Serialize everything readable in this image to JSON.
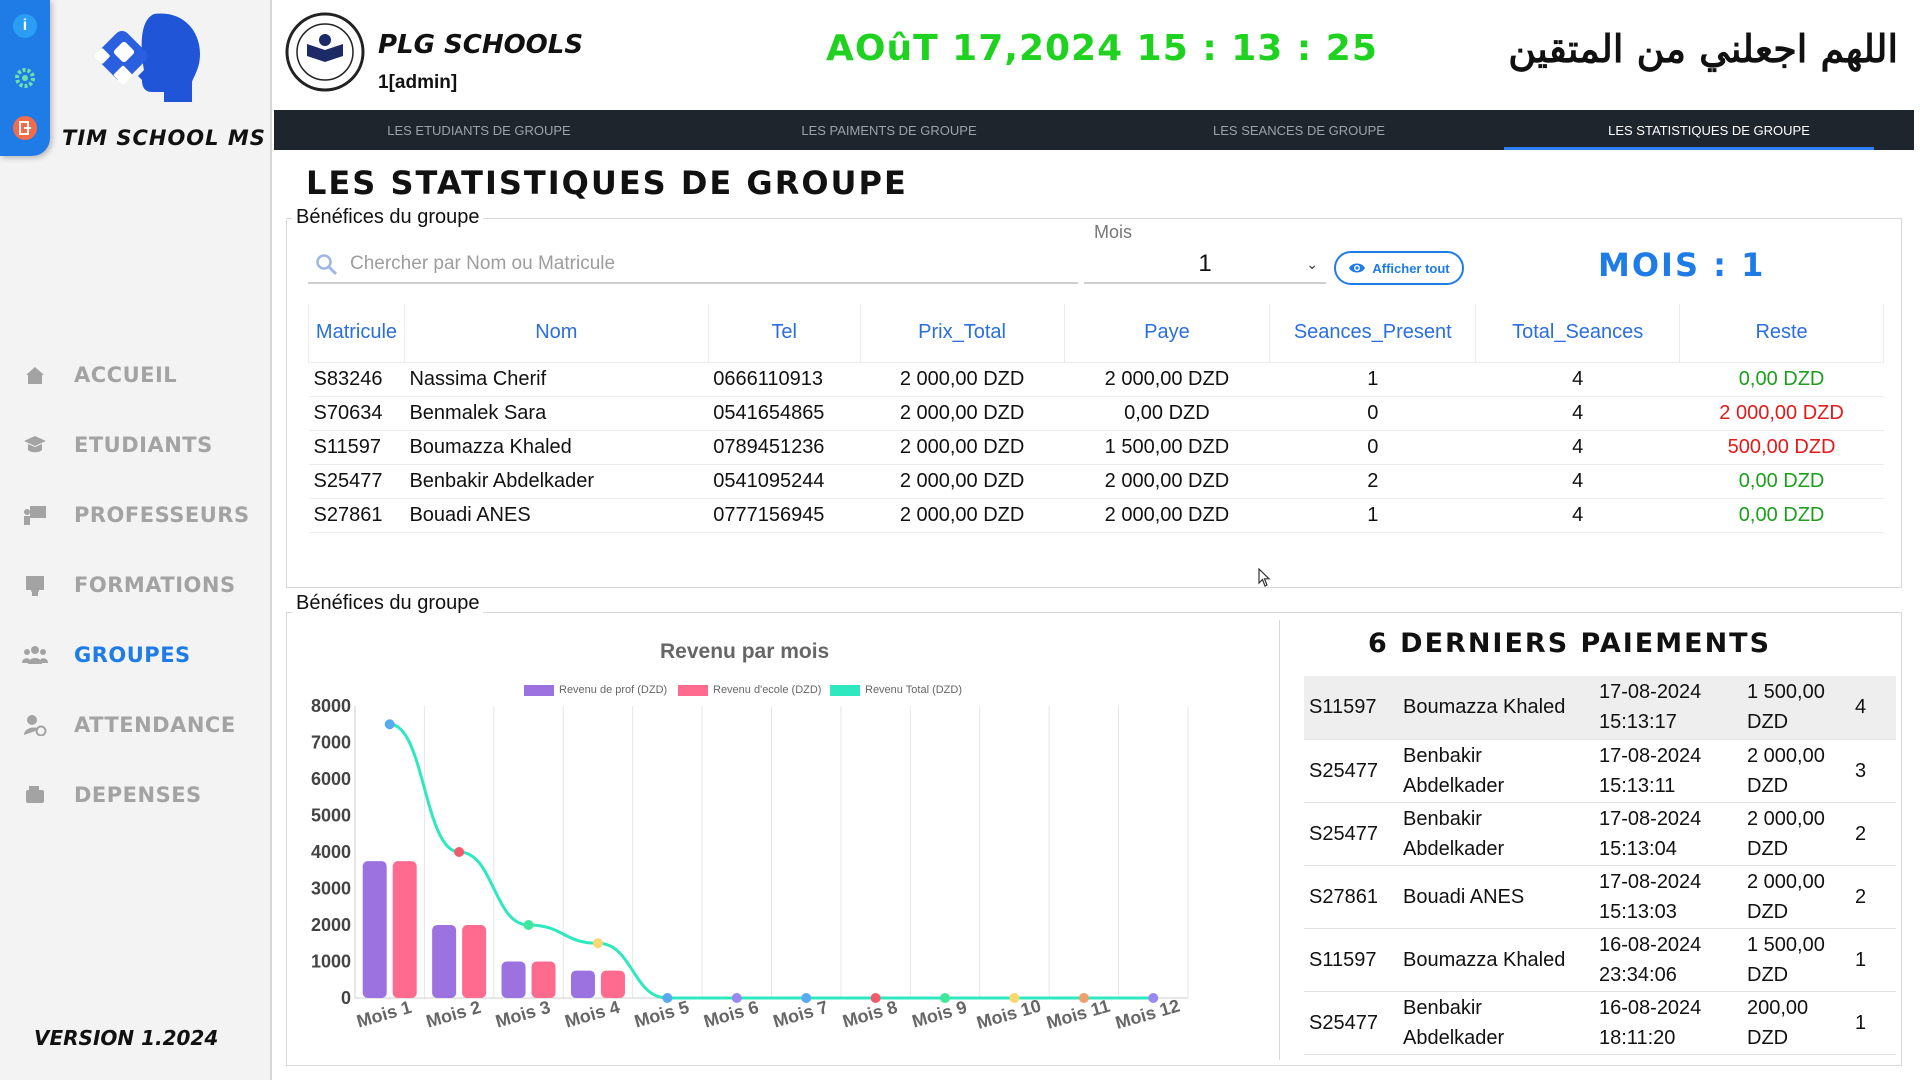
{
  "app": {
    "brand": "TIM SCHOOL MS",
    "version": "VERSION 1.2024",
    "accent": "#1f7be6"
  },
  "quick_actions": [
    {
      "icon": "info-icon",
      "label": "i"
    },
    {
      "icon": "gear-icon",
      "label": ""
    },
    {
      "icon": "logout-icon",
      "label": ""
    }
  ],
  "sidebar": {
    "items": [
      {
        "label": "ACCUEIL",
        "icon": "home-icon",
        "active": false
      },
      {
        "label": "ETUDIANTS",
        "icon": "graduation-cap-icon",
        "active": false
      },
      {
        "label": "PROFESSEURS",
        "icon": "teacher-board-icon",
        "active": false
      },
      {
        "label": "FORMATIONS",
        "icon": "certificate-icon",
        "active": false
      },
      {
        "label": "GROUPES",
        "icon": "users-icon",
        "active": true
      },
      {
        "label": "ATTENDANCE",
        "icon": "user-clock-icon",
        "active": false
      },
      {
        "label": "DEPENSES",
        "icon": "wallet-icon",
        "active": false
      }
    ]
  },
  "header": {
    "school_name": "PLG SCHOOLS",
    "user": "1[admin]",
    "datetime": "AOûT 17,2024 15 : 13 : 25",
    "arabic": "اللهم اجعلني من المتقين",
    "clock_color": "#1fd21f"
  },
  "tabs": [
    {
      "label": "LES ETUDIANTS DE GROUPE",
      "active": false
    },
    {
      "label": "LES PAIMENTS DE GROUPE",
      "active": false
    },
    {
      "label": "LES SEANCES DE GROUPE",
      "active": false
    },
    {
      "label": "LES STATISTIQUES DE GROUPE",
      "active": true
    }
  ],
  "page_title": "LES STATISTIQUES DE GROUPE",
  "benefices": {
    "legend": "Bénéfices du groupe",
    "search_placeholder": "Chercher par Nom ou Matricule",
    "mois_label": "Mois",
    "mois_value": "1",
    "show_all": "Afficher tout",
    "mois_display": "MOIS : 1",
    "columns": [
      "Matricule",
      "Nom",
      "Tel",
      "Prix_Total",
      "Paye",
      "Seances_Present",
      "Total_Seances",
      "Reste"
    ],
    "rows": [
      {
        "matricule": "S83246",
        "nom": "Nassima Cherif",
        "tel": "0666110913",
        "prix": "2 000,00 DZD",
        "paye": "2 000,00 DZD",
        "present": "1",
        "total": "4",
        "reste": "0,00 DZD",
        "reste_status": "paid"
      },
      {
        "matricule": "S70634",
        "nom": "Benmalek Sara",
        "tel": "0541654865",
        "prix": "2 000,00 DZD",
        "paye": "0,00 DZD",
        "present": "0",
        "total": "4",
        "reste": "2 000,00 DZD",
        "reste_status": "due"
      },
      {
        "matricule": "S11597",
        "nom": "Boumazza Khaled",
        "tel": "0789451236",
        "prix": "2 000,00 DZD",
        "paye": "1 500,00 DZD",
        "present": "0",
        "total": "4",
        "reste": "500,00 DZD",
        "reste_status": "due"
      },
      {
        "matricule": "S25477",
        "nom": "Benbakir Abdelkader",
        "tel": "0541095244",
        "prix": "2 000,00 DZD",
        "paye": "2 000,00 DZD",
        "present": "2",
        "total": "4",
        "reste": "0,00 DZD",
        "reste_status": "paid"
      },
      {
        "matricule": "S27861",
        "nom": "Bouadi ANES",
        "tel": "0777156945",
        "prix": "2 000,00 DZD",
        "paye": "2 000,00 DZD",
        "present": "1",
        "total": "4",
        "reste": "0,00 DZD",
        "reste_status": "paid"
      }
    ]
  },
  "panel2_legend": "Bénéfices du groupe",
  "chart_data": {
    "type": "bar",
    "title": "Revenu par mois",
    "categories": [
      "Mois 1",
      "Mois 2",
      "Mois 3",
      "Mois 4",
      "Mois 5",
      "Mois 6",
      "Mois 7",
      "Mois 8",
      "Mois 9",
      "Mois 10",
      "Mois 11",
      "Mois 12"
    ],
    "series": [
      {
        "name": "Revenu de prof (DZD)",
        "type": "bar",
        "color": "#9b72e0",
        "values": [
          3750,
          2000,
          1000,
          750,
          0,
          0,
          0,
          0,
          0,
          0,
          0,
          0
        ]
      },
      {
        "name": "Revenu d'ecole (DZD)",
        "type": "bar",
        "color": "#ff6b8f",
        "values": [
          3750,
          2000,
          1000,
          750,
          0,
          0,
          0,
          0,
          0,
          0,
          0,
          0
        ]
      },
      {
        "name": "Revenu Total (DZD)",
        "type": "line",
        "color": "#2ee8c0",
        "values": [
          7500,
          4000,
          2000,
          1500,
          0,
          0,
          0,
          0,
          0,
          0,
          0,
          0
        ]
      }
    ],
    "point_colors": [
      "#5aaaf0",
      "#f05a6a",
      "#3ee89a",
      "#f8d870",
      "#5aaaf0",
      "#9a88f0",
      "#5aaaf0",
      "#f05a6a",
      "#3ee89a",
      "#f8d870",
      "#f0a070",
      "#9a88f0"
    ],
    "ylim": [
      0,
      8000
    ],
    "yticks": [
      "8000",
      "7000",
      "6000",
      "5000",
      "4000",
      "3000",
      "2000",
      "1000",
      "0"
    ],
    "grid": true,
    "legend_position": "top"
  },
  "last_payments": {
    "title": "6 DERNIERS PAIEMENTS",
    "rows": [
      {
        "matricule": "S11597",
        "nom": "Boumazza Khaled",
        "date": "17-08-2024",
        "time": "15:13:17",
        "amount": "1 500,00",
        "currency": "DZD",
        "seances": "4"
      },
      {
        "matricule": "S25477",
        "nom": "Benbakir",
        "nom2": "Abdelkader",
        "date": "17-08-2024",
        "time": "15:13:11",
        "amount": "2 000,00",
        "currency": "DZD",
        "seances": "3"
      },
      {
        "matricule": "S25477",
        "nom": "Benbakir",
        "nom2": "Abdelkader",
        "date": "17-08-2024",
        "time": "15:13:04",
        "amount": "2 000,00",
        "currency": "DZD",
        "seances": "2"
      },
      {
        "matricule": "S27861",
        "nom": "Bouadi ANES",
        "date": "17-08-2024",
        "time": "15:13:03",
        "amount": "2 000,00",
        "currency": "DZD",
        "seances": "2"
      },
      {
        "matricule": "S11597",
        "nom": "Boumazza Khaled",
        "date": "16-08-2024",
        "time": "23:34:06",
        "amount": "1 500,00",
        "currency": "DZD",
        "seances": "1"
      },
      {
        "matricule": "S25477",
        "nom": "Benbakir",
        "nom2": "Abdelkader",
        "date": "16-08-2024",
        "time": "18:11:20",
        "amount": "200,00",
        "currency": "DZD",
        "seances": "1"
      }
    ]
  }
}
